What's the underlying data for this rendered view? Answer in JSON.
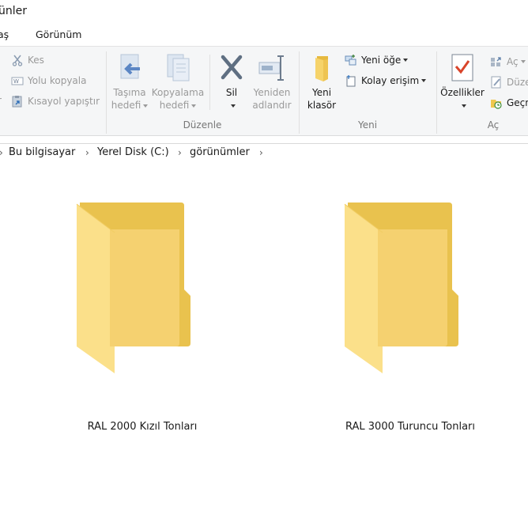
{
  "window": {
    "title": "ünler"
  },
  "tabs": [
    {
      "label": "aş"
    },
    {
      "label": "Görünüm"
    }
  ],
  "ribbon": {
    "clipboard": {
      "cut": "Kes",
      "copy_path": "Yolu kopyala",
      "paste_shortcut": "Kısayol yapıştır"
    },
    "organize": {
      "label": "Düzenle",
      "move_to_line1": "Taşıma",
      "move_to_line2": "hedefi",
      "copy_to_line1": "Kopyalama",
      "copy_to_line2": "hedefi",
      "delete": "Sil",
      "rename_line1": "Yeniden",
      "rename_line2": "adlandır"
    },
    "new": {
      "label": "Yeni",
      "new_folder_line1": "Yeni",
      "new_folder_line2": "klasör",
      "new_item": "Yeni öğe",
      "easy_access": "Kolay erişim"
    },
    "open": {
      "label": "Aç",
      "properties": "Özellikler",
      "open": "Aç",
      "edit": "Düze",
      "history": "Geçm"
    }
  },
  "address": {
    "crumbs": [
      "Bu bilgisayar",
      "Yerel Disk (C:)",
      "görünümler"
    ]
  },
  "items": [
    {
      "name": "RAL 2000 Kızıl Tonları"
    },
    {
      "name": "RAL 3000 Turuncu Tonları"
    }
  ],
  "colors": {
    "folder_back": "#e9c24e",
    "folder_front": "#f8d775",
    "accent": "#0078d7"
  }
}
